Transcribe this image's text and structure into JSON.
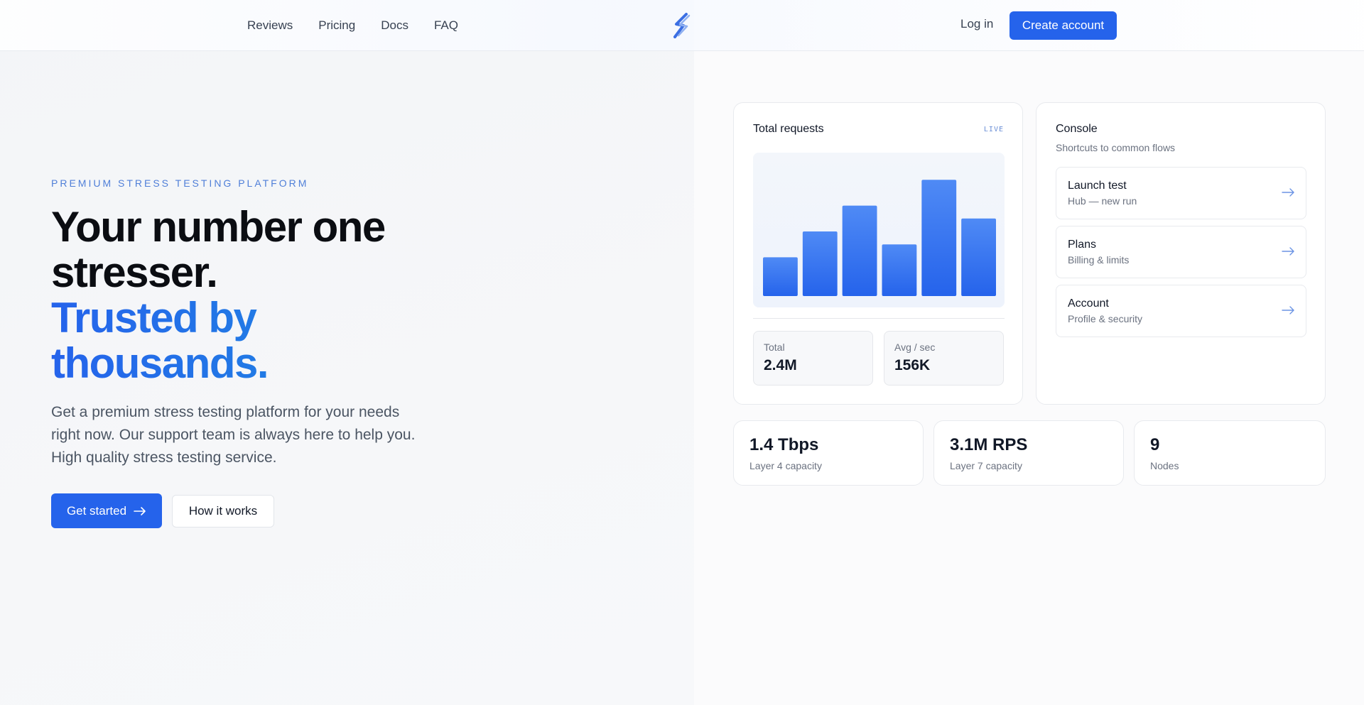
{
  "nav": {
    "links": [
      "Reviews",
      "Pricing",
      "Docs",
      "FAQ"
    ],
    "login": "Log in",
    "create_account": "Create account",
    "logo_icon": "lightning-s-logo-icon"
  },
  "hero": {
    "eyebrow": "PREMIUM STRESS TESTING PLATFORM",
    "headline_line1": "Your number one stresser.",
    "headline_line2": "Trusted by thousands.",
    "subtitle": "Get a premium stress testing platform for your needs right now. Our support team is always here to help you. High quality stress testing service.",
    "primary_button": "Get started",
    "secondary_button": "How it works"
  },
  "requests_card": {
    "title": "Total requests",
    "badge": "LIVE",
    "stats": [
      {
        "label": "Total",
        "value": "2.4M"
      },
      {
        "label": "Avg / sec",
        "value": "156K"
      }
    ]
  },
  "chart_data": {
    "type": "bar",
    "values": [
      30,
      50,
      70,
      40,
      90,
      60
    ],
    "ylim": [
      0,
      100
    ],
    "title": "",
    "xlabel": "",
    "ylabel": "",
    "grid": false
  },
  "console": {
    "title": "Console",
    "subtitle": "Shortcuts to common flows",
    "items": [
      {
        "title": "Launch test",
        "desc": "Hub — new run"
      },
      {
        "title": "Plans",
        "desc": "Billing & limits"
      },
      {
        "title": "Account",
        "desc": "Profile & security"
      }
    ]
  },
  "metrics": [
    {
      "value": "1.4 Tbps",
      "label": "Layer 4 capacity"
    },
    {
      "value": "3.1M RPS",
      "label": "Layer 7 capacity"
    },
    {
      "value": "9",
      "label": "Nodes"
    }
  ],
  "colors": {
    "accent": "#2563eb",
    "accent_light": "#1f8ee0",
    "eyebrow": "#4f7fd8"
  }
}
